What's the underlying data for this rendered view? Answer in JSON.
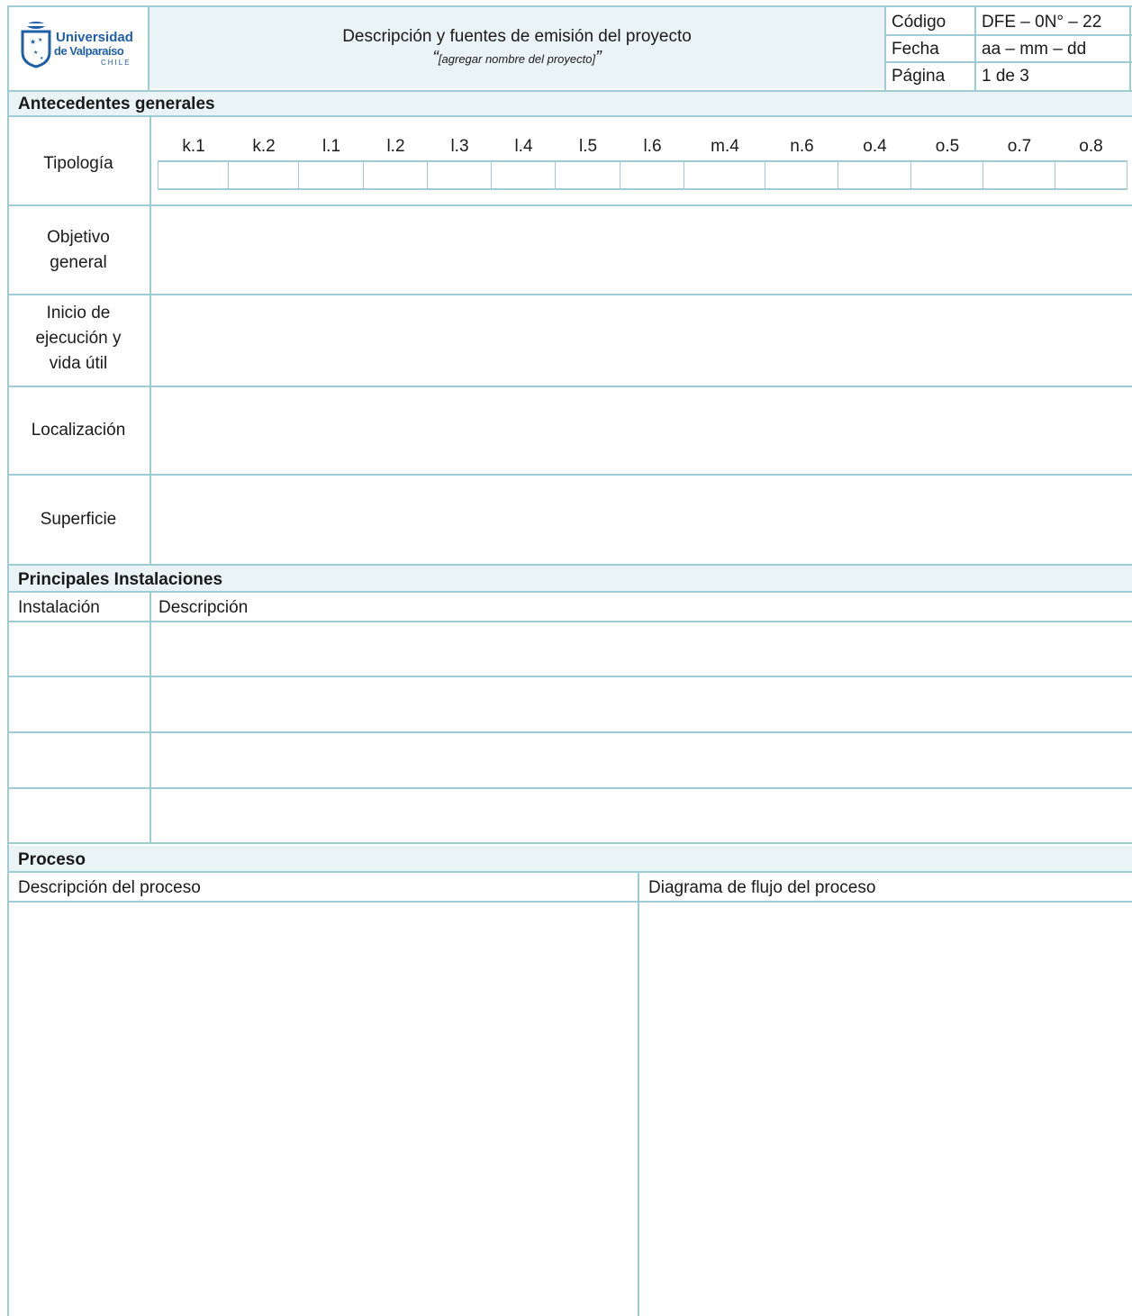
{
  "header": {
    "logo": {
      "line1": "Universidad",
      "line2": "de Valparaíso",
      "line3": "CHILE",
      "icon": "university-crest-icon"
    },
    "title": "Descripción y fuentes de emisión del proyecto",
    "subtitle_open": "“",
    "subtitle": "[agregar nombre del proyecto]",
    "subtitle_close": "”",
    "meta": [
      {
        "label": "Código",
        "value": "DFE – 0N° – 22"
      },
      {
        "label": "Fecha",
        "value": "aa – mm – dd"
      },
      {
        "label": "Página",
        "value": "1 de 3"
      }
    ]
  },
  "antecedentes": {
    "heading": "Antecedentes generales",
    "tipologia_label": "Tipología",
    "tipologia_codes": [
      "k.1",
      "k.2",
      "l.1",
      "l.2",
      "l.3",
      "l.4",
      "l.5",
      "l.6",
      "m.4",
      "n.6",
      "o.4",
      "o.5",
      "o.7",
      "o.8"
    ],
    "rows": [
      {
        "label_lines": [
          "Objetivo",
          "general"
        ]
      },
      {
        "label_lines": [
          "Inicio de",
          "ejecución y",
          "vida útil"
        ]
      },
      {
        "label_lines": [
          "Localización"
        ]
      },
      {
        "label_lines": [
          "Superficie"
        ]
      }
    ]
  },
  "instalaciones": {
    "heading": "Principales Instalaciones",
    "col_instalacion": "Instalación",
    "col_descripcion": "Descripción"
  },
  "proceso": {
    "heading": "Proceso",
    "col_descripcion": "Descripción del proceso",
    "col_diagrama": "Diagrama de flujo del proceso"
  },
  "colors": {
    "border": "#9fcbd3",
    "band": "#eaf3f5",
    "logo_blue": "#1f5fa8"
  }
}
